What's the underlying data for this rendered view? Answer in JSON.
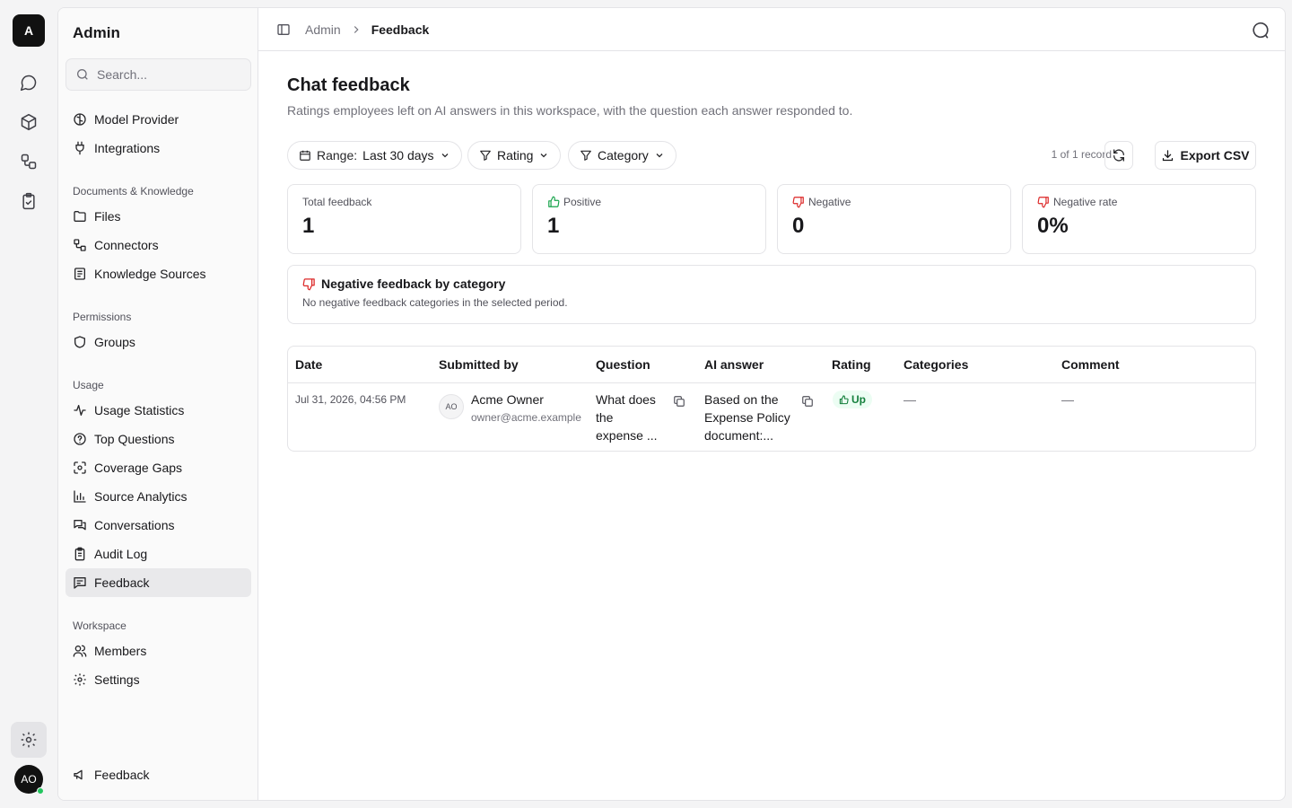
{
  "rail": {
    "logo": "A",
    "icons": [
      "chat-icon",
      "cube-icon",
      "workflow-icon",
      "clipboard-check-icon"
    ],
    "settings_icon": "gear-icon",
    "avatar_initials": "AO",
    "status_color": "#22c55e"
  },
  "sidebar": {
    "title": "Admin",
    "search_placeholder": "Search...",
    "top_items": [
      {
        "label": "Model Provider",
        "icon": "brain-icon"
      },
      {
        "label": "Integrations",
        "icon": "plug-icon"
      }
    ],
    "sections": [
      {
        "title": "Documents & Knowledge",
        "items": [
          {
            "label": "Files",
            "icon": "folder-icon"
          },
          {
            "label": "Connectors",
            "icon": "connectors-icon"
          },
          {
            "label": "Knowledge Sources",
            "icon": "book-icon"
          }
        ]
      },
      {
        "title": "Permissions",
        "items": [
          {
            "label": "Groups",
            "icon": "shield-icon"
          }
        ]
      },
      {
        "title": "Usage",
        "items": [
          {
            "label": "Usage Statistics",
            "icon": "activity-icon"
          },
          {
            "label": "Top Questions",
            "icon": "help-circle-icon"
          },
          {
            "label": "Coverage Gaps",
            "icon": "scan-icon"
          },
          {
            "label": "Source Analytics",
            "icon": "bar-chart-icon"
          },
          {
            "label": "Conversations",
            "icon": "messages-icon"
          },
          {
            "label": "Audit Log",
            "icon": "clipboard-icon"
          },
          {
            "label": "Feedback",
            "icon": "message-square-icon",
            "active": true
          }
        ]
      },
      {
        "title": "Workspace",
        "items": [
          {
            "label": "Members",
            "icon": "users-icon"
          },
          {
            "label": "Settings",
            "icon": "gear-icon"
          }
        ]
      }
    ],
    "footer_item": {
      "label": "Feedback",
      "icon": "megaphone-icon"
    }
  },
  "breadcrumb": {
    "parent": "Admin",
    "current": "Feedback"
  },
  "page": {
    "title": "Chat feedback",
    "subtitle": "Ratings employees left on AI answers in this workspace, with the question each answer responded to."
  },
  "filters": {
    "range_label": "Range:",
    "range_value": "Last 30 days",
    "rating_label": "Rating",
    "category_label": "Category",
    "records_text": "1 of 1 record",
    "export_label": "Export CSV"
  },
  "stats": {
    "total": {
      "label": "Total feedback",
      "value": "1"
    },
    "positive": {
      "label": "Positive",
      "value": "1"
    },
    "negative": {
      "label": "Negative",
      "value": "0"
    },
    "negative_rate": {
      "label": "Negative rate",
      "value": "0%"
    }
  },
  "category_box": {
    "title": "Negative feedback by category",
    "note": "No negative feedback categories in the selected period."
  },
  "table": {
    "headers": {
      "date": "Date",
      "submitted_by": "Submitted by",
      "question": "Question",
      "ai_answer": "AI answer",
      "rating": "Rating",
      "categories": "Categories",
      "comment": "Comment"
    },
    "rows": [
      {
        "date": "Jul 31, 2026, 04:56 PM",
        "initials": "AO",
        "name": "Acme Owner",
        "email": "owner@acme.example",
        "question_l1": "What does",
        "question_l2": "the",
        "question_l3": "expense ...",
        "answer_l1": "Based on the",
        "answer_l2": "Expense Policy",
        "answer_l3": "document:...",
        "rating": "Up",
        "categories": "—",
        "comment": "—"
      }
    ]
  },
  "colors": {
    "positive": "#16a34a",
    "negative": "#dc2626",
    "accent": "#18181b"
  }
}
